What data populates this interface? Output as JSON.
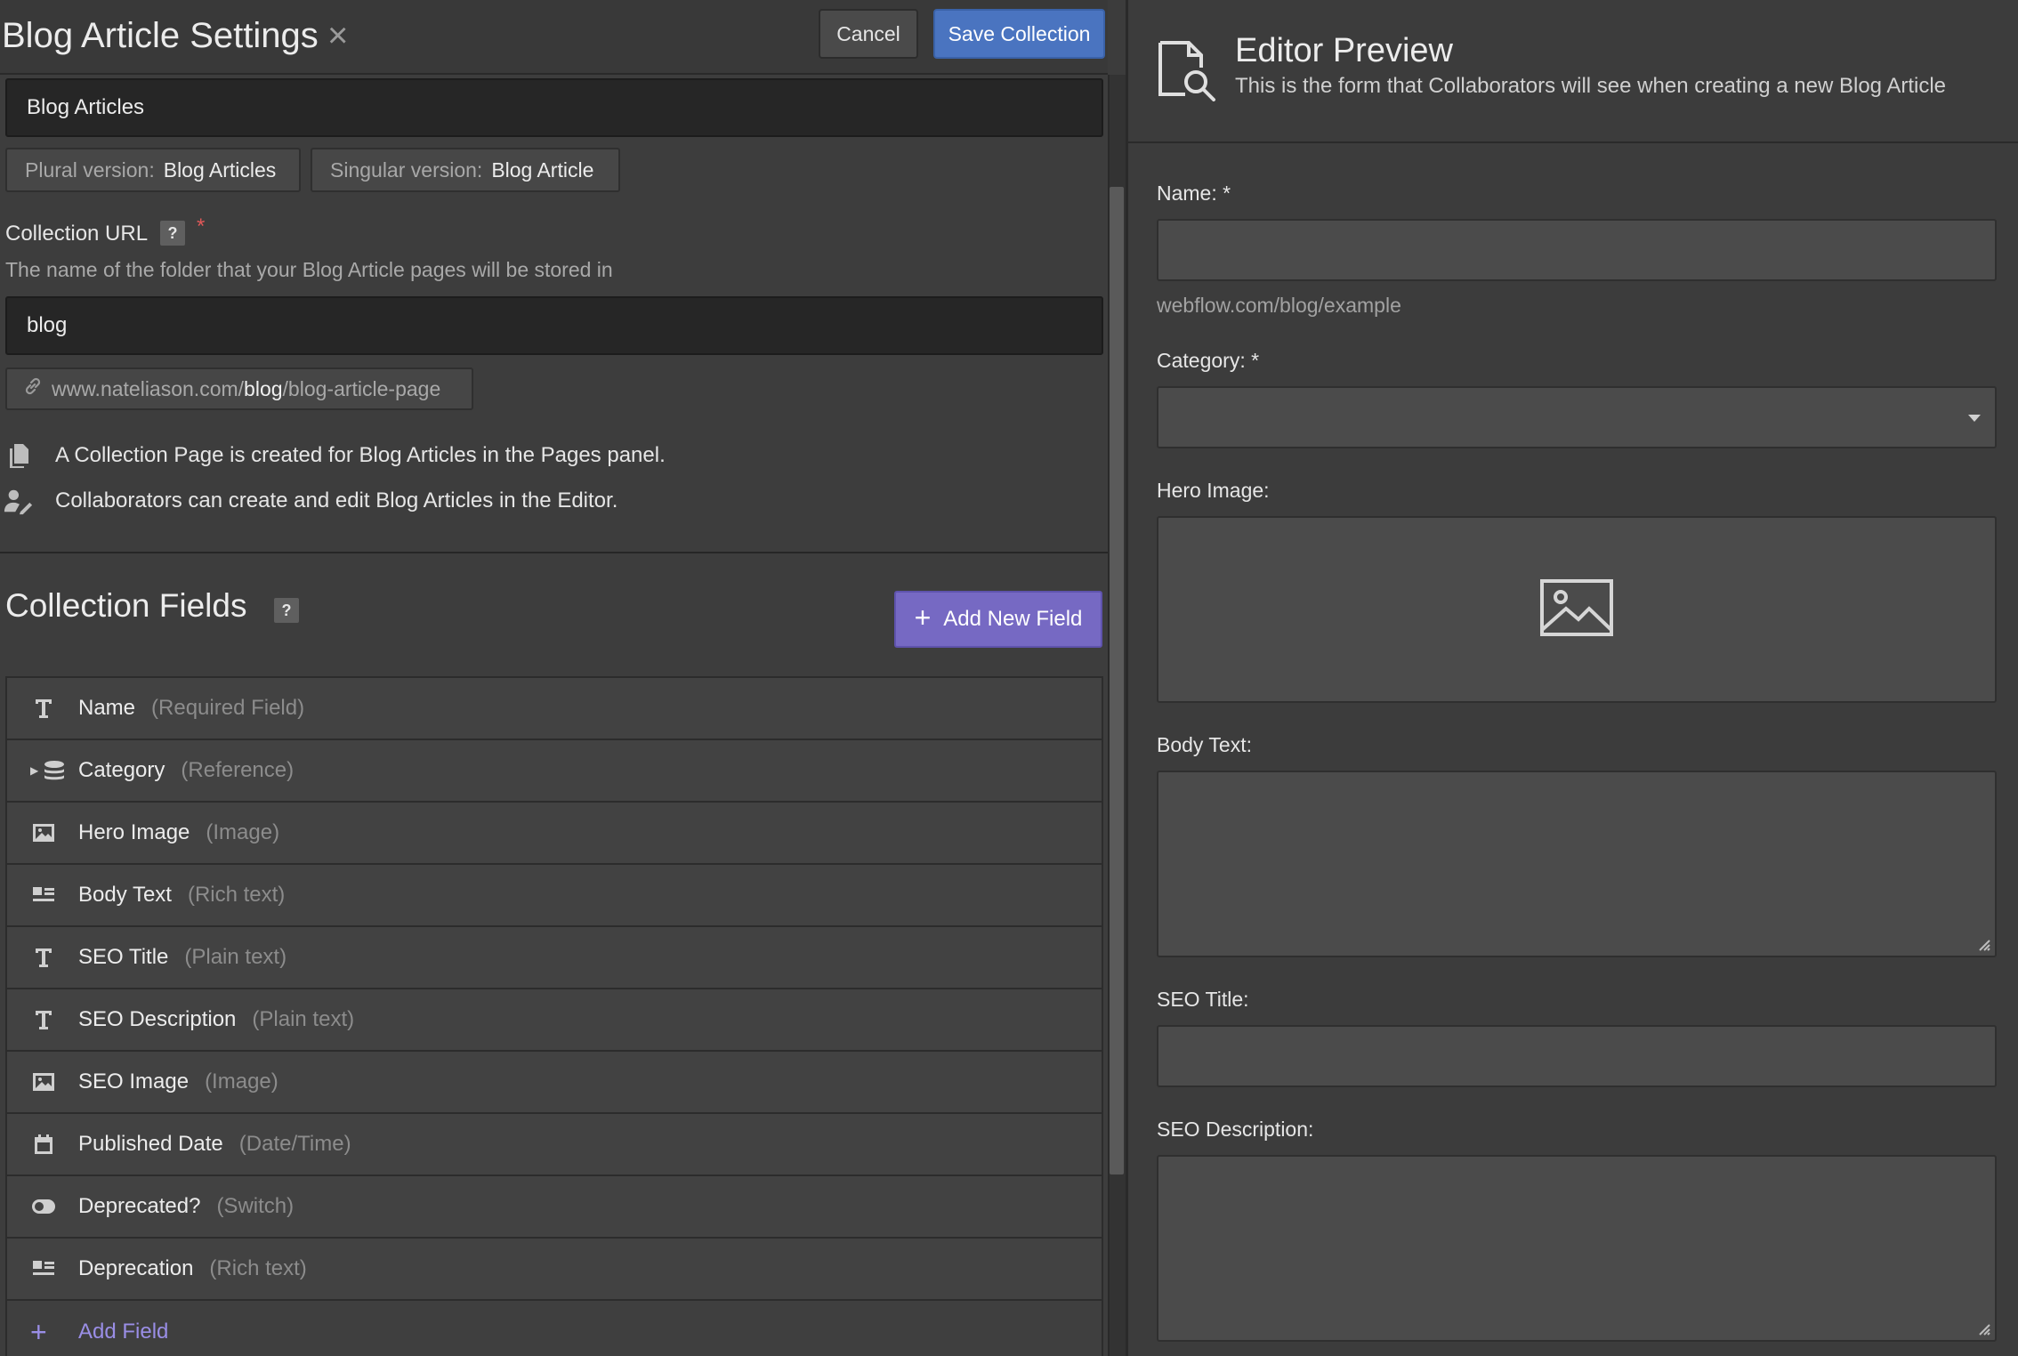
{
  "settings": {
    "title": "Blog Article Settings",
    "close_icon": "close-icon",
    "cancel_label": "Cancel",
    "save_label": "Save Collection",
    "collection_name": "Blog Articles",
    "plural_label": "Plural version:",
    "plural_value": "Blog Articles",
    "singular_label": "Singular version:",
    "singular_value": "Blog Article",
    "url_label": "Collection URL",
    "url_help": "?",
    "url_required": "*",
    "url_description": "The name of the folder that your Blog Article pages will be stored in",
    "url_value": "blog",
    "url_preview_prefix": "www.nateliason.com/",
    "url_preview_slug": "blog",
    "url_preview_suffix": "/blog-article-page",
    "info_page": "A Collection Page is created for Blog Articles in the Pages panel.",
    "info_editor": "Collaborators can create and edit Blog Articles in the Editor."
  },
  "fields": {
    "title": "Collection Fields",
    "help": "?",
    "add_new_label": "Add New Field",
    "add_field_label": "Add Field",
    "items": [
      {
        "name": "Name",
        "type": "(Required Field)",
        "icon": "text-icon"
      },
      {
        "name": "Category",
        "type": "(Reference)",
        "icon": "reference-icon"
      },
      {
        "name": "Hero Image",
        "type": "(Image)",
        "icon": "image-icon"
      },
      {
        "name": "Body Text",
        "type": "(Rich text)",
        "icon": "rich-text-icon"
      },
      {
        "name": "SEO Title",
        "type": "(Plain text)",
        "icon": "text-icon"
      },
      {
        "name": "SEO Description",
        "type": "(Plain text)",
        "icon": "text-icon"
      },
      {
        "name": "SEO Image",
        "type": "(Image)",
        "icon": "image-icon"
      },
      {
        "name": "Published Date",
        "type": "(Date/Time)",
        "icon": "calendar-icon"
      },
      {
        "name": "Deprecated?",
        "type": "(Switch)",
        "icon": "switch-icon"
      },
      {
        "name": "Deprecation",
        "type": "(Rich text)",
        "icon": "rich-text-icon"
      }
    ]
  },
  "preview": {
    "title": "Editor Preview",
    "subtitle": "This is the form that Collaborators will see when creating a new Blog Article",
    "name_label": "Name: *",
    "url_hint": "webflow.com/blog/example",
    "category_label": "Category: *",
    "hero_label": "Hero Image:",
    "body_label": "Body Text:",
    "seo_title_label": "SEO Title:",
    "seo_desc_label": "SEO Description:"
  },
  "colors": {
    "save_button": "#4a74c0",
    "add_button": "#7669c3",
    "required": "#e05858"
  }
}
